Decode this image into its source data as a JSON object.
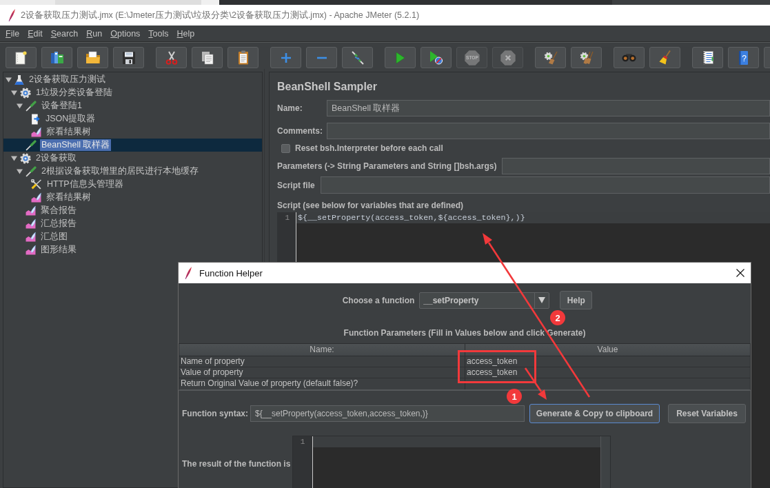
{
  "window": {
    "title": "2设备获取压力测试.jmx (E:\\Jmeter压力测试\\垃圾分类\\2设备获取压力测试.jmx) - Apache JMeter (5.2.1)"
  },
  "menu": [
    "File",
    "Edit",
    "Search",
    "Run",
    "Options",
    "Tools",
    "Help"
  ],
  "toolbar": [
    {
      "buttons": [
        {
          "kind": "new",
          "disabled": false
        },
        {
          "kind": "templates",
          "disabled": false
        },
        {
          "kind": "open",
          "disabled": false
        },
        {
          "kind": "save",
          "disabled": false
        }
      ]
    },
    {
      "buttons": [
        {
          "kind": "cut",
          "disabled": false
        },
        {
          "kind": "copy",
          "disabled": false
        },
        {
          "kind": "paste",
          "disabled": false
        }
      ]
    },
    {
      "buttons": [
        {
          "kind": "expand",
          "disabled": false
        },
        {
          "kind": "collapse",
          "disabled": false
        },
        {
          "kind": "toggle",
          "disabled": false
        }
      ]
    },
    {
      "buttons": [
        {
          "kind": "start",
          "disabled": false
        },
        {
          "kind": "start-no-pauses",
          "disabled": false
        },
        {
          "kind": "stop",
          "disabled": true,
          "glyph": "STOP"
        },
        {
          "kind": "shutdown",
          "disabled": true
        }
      ]
    },
    {
      "buttons": [
        {
          "kind": "clear",
          "disabled": false
        },
        {
          "kind": "clear-all",
          "disabled": false
        }
      ]
    },
    {
      "buttons": [
        {
          "kind": "search",
          "disabled": false
        },
        {
          "kind": "reset-search",
          "disabled": false
        }
      ]
    },
    {
      "buttons": [
        {
          "kind": "function-helper",
          "disabled": false
        },
        {
          "kind": "help",
          "disabled": false,
          "glyph": "?"
        },
        {
          "kind": "unknown",
          "disabled": false
        }
      ]
    }
  ],
  "tree": [
    {
      "label": "2设备获取压力测试",
      "kind": "test-plan",
      "expanded": true,
      "selected": false,
      "children": [
        {
          "label": "1垃圾分类设备登陆",
          "kind": "thread-group",
          "expanded": true,
          "selected": false,
          "children": [
            {
              "label": "设备登陆1",
              "kind": "sampler",
              "expanded": true,
              "selected": false,
              "children": [
                {
                  "label": "JSON提取器",
                  "kind": "extractor",
                  "selected": false
                },
                {
                  "label": "察看结果树",
                  "kind": "listener",
                  "selected": false
                }
              ]
            },
            {
              "label": "BeanShell 取样器",
              "kind": "sampler",
              "selected": true
            }
          ]
        },
        {
          "label": "2设备获取",
          "kind": "thread-group",
          "expanded": true,
          "selected": false,
          "children": [
            {
              "label": "2根据设备获取增里的居民进行本地缓存",
              "kind": "sampler",
              "expanded": true,
              "selected": false,
              "children": [
                {
                  "label": "HTTP信息头管理器",
                  "kind": "config",
                  "selected": false
                },
                {
                  "label": "察看结果树",
                  "kind": "listener",
                  "selected": false
                }
              ]
            },
            {
              "label": "聚合报告",
              "kind": "listener",
              "selected": false
            },
            {
              "label": "汇总报告",
              "kind": "listener",
              "selected": false
            },
            {
              "label": "汇总图",
              "kind": "listener",
              "selected": false
            },
            {
              "label": "图形结果",
              "kind": "listener",
              "selected": false
            }
          ]
        }
      ]
    }
  ],
  "sampler": {
    "title": "BeanShell Sampler",
    "name_field": {
      "label": "Name:",
      "value": "BeanShell 取样器"
    },
    "comments_field": {
      "label": "Comments:"
    },
    "reset_option": {
      "label": "Reset bsh.Interpreter before each call",
      "checked": false
    },
    "parameters_field": {
      "label": "Parameters (-> String Parameters and String []bsh.args)"
    },
    "script_file_field": {
      "label": "Script file"
    },
    "script": {
      "label": "Script (see below for variables that are defined)",
      "lines": [
        {
          "number": "1",
          "text": "${__setProperty(access_token,${access_token},)}",
          "current": true
        }
      ]
    }
  },
  "function_helper": {
    "title": "Function Helper",
    "function_label": "Choose a function",
    "function_select": {
      "value": "__setProperty"
    },
    "help_button": "Help",
    "parameters_heading": "Function Parameters (Fill in Values below and click Generate)",
    "parameters_table": {
      "columns": [
        "Name:",
        "Value"
      ],
      "rows": [
        {
          "name": "Name of property",
          "value": "access_token"
        },
        {
          "name": "Value of property",
          "value": "access_token"
        },
        {
          "name": "Return Original Value of property (default false)?"
        }
      ]
    },
    "syntax_label": "Function syntax:",
    "syntax_field": {
      "value": "${__setProperty(access_token,access_token,)}"
    },
    "buttons": [
      {
        "label": "Generate & Copy to clipboard",
        "focused": true
      },
      {
        "label": "Reset Variables",
        "focused": false
      }
    ],
    "result_label": "The result of the function is",
    "result_editor": {
      "lines": [
        {
          "number": "1",
          "current": true
        }
      ]
    }
  },
  "annotations": {
    "markers": [
      {
        "number": "1"
      },
      {
        "number": "2"
      }
    ]
  }
}
